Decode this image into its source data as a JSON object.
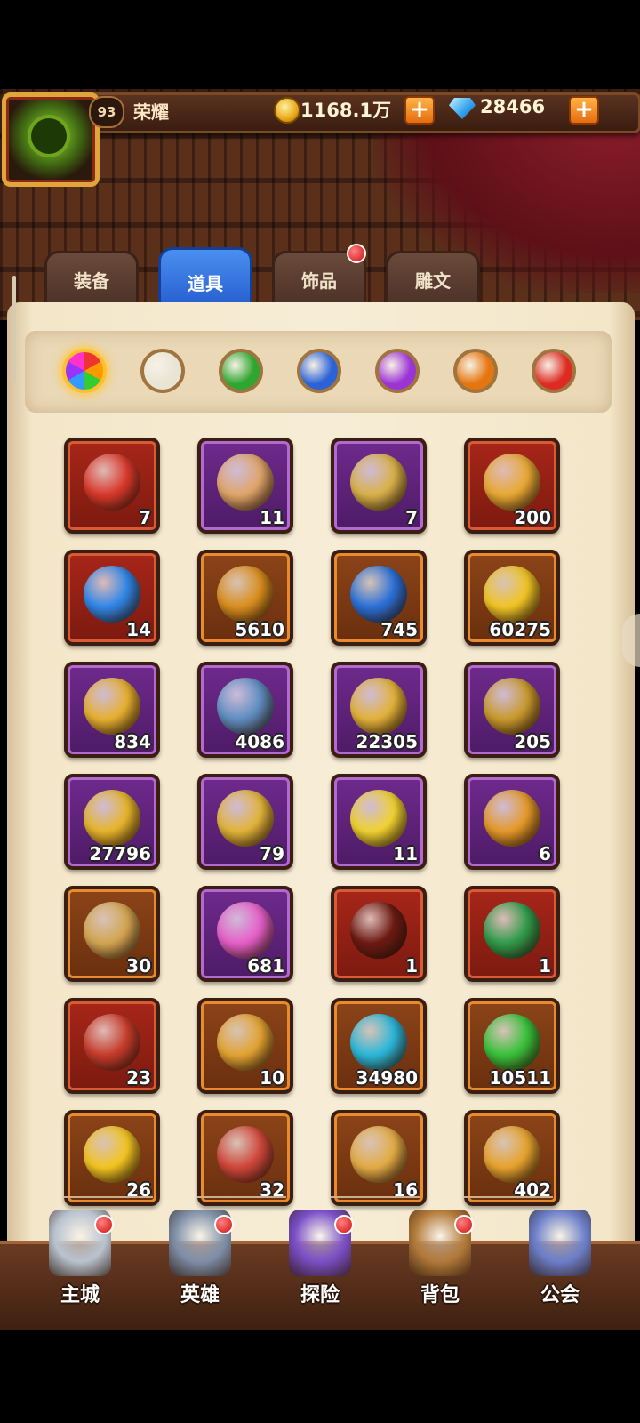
{
  "header": {
    "level": "93",
    "player_name": "荣耀",
    "gold": "1168.1万",
    "gems": "28466"
  },
  "tabs": [
    {
      "label": "装备",
      "active": false,
      "badge": false
    },
    {
      "label": "道具",
      "active": true,
      "badge": false
    },
    {
      "label": "饰品",
      "active": false,
      "badge": true
    },
    {
      "label": "雕文",
      "active": false,
      "badge": false
    }
  ],
  "color_filters": [
    {
      "name": "all",
      "color": "rainbow",
      "selected": true
    },
    {
      "name": "white",
      "color": "#e9e4d4",
      "selected": false
    },
    {
      "name": "green",
      "color": "#2fa630",
      "selected": false
    },
    {
      "name": "blue",
      "color": "#2b62d6",
      "selected": false
    },
    {
      "name": "purple",
      "color": "#9b34d4",
      "selected": false
    },
    {
      "name": "orange",
      "color": "#e5750f",
      "selected": false
    },
    {
      "name": "red",
      "color": "#dd2b22",
      "selected": false
    }
  ],
  "items": [
    {
      "name": "gold-pouch",
      "tier": "red",
      "qty": "7",
      "icon_color": "#d9382a"
    },
    {
      "name": "scroll",
      "tier": "purple",
      "qty": "11",
      "icon_color": "#e0a56a"
    },
    {
      "name": "treasure-chest-blue",
      "tier": "purple",
      "qty": "7",
      "icon_color": "#d9b14a"
    },
    {
      "name": "eagle-coin",
      "tier": "red",
      "qty": "200",
      "icon_color": "#e8a935"
    },
    {
      "name": "blue-stone",
      "tier": "red",
      "qty": "14",
      "icon_color": "#2f86e8"
    },
    {
      "name": "skull-coin",
      "tier": "orange",
      "qty": "5610",
      "icon_color": "#d98e1e"
    },
    {
      "name": "blue-crystal-ornament",
      "tier": "orange",
      "qty": "745",
      "icon_color": "#2a70d8"
    },
    {
      "name": "monkey-coin",
      "tier": "orange",
      "qty": "60275",
      "icon_color": "#f0c425"
    },
    {
      "name": "sun-badge",
      "tier": "purple",
      "qty": "834",
      "icon_color": "#e6b030"
    },
    {
      "name": "lightning-rune-stone",
      "tier": "purple",
      "qty": "4086",
      "icon_color": "#5f8ec2"
    },
    {
      "name": "winged-emblem",
      "tier": "purple",
      "qty": "22305",
      "icon_color": "#e2b23a"
    },
    {
      "name": "purple-gem-shield",
      "tier": "purple",
      "qty": "205",
      "icon_color": "#c99a2e"
    },
    {
      "name": "gold-shield",
      "tier": "purple",
      "qty": "27796",
      "icon_color": "#e6b52c"
    },
    {
      "name": "puzzle-piece",
      "tier": "purple",
      "qty": "79",
      "icon_color": "#e2b43a"
    },
    {
      "name": "gold-crystal",
      "tier": "purple",
      "qty": "11",
      "icon_color": "#f0d232"
    },
    {
      "name": "hex-coin",
      "tier": "purple",
      "qty": "6",
      "icon_color": "#e59a2a"
    },
    {
      "name": "star-coin",
      "tier": "orange",
      "qty": "30",
      "icon_color": "#d3a552"
    },
    {
      "name": "fireworks",
      "tier": "purple",
      "qty": "681",
      "icon_color": "#e65fc9"
    },
    {
      "name": "frame",
      "tier": "red",
      "qty": "1",
      "icon_color": "#6c1a12"
    },
    {
      "name": "green-chest",
      "tier": "red",
      "qty": "1",
      "icon_color": "#2f9b4a"
    },
    {
      "name": "red-chest",
      "tier": "red",
      "qty": "23",
      "icon_color": "#c63b2a"
    },
    {
      "name": "gold-chest",
      "tier": "orange",
      "qty": "10",
      "icon_color": "#e2a332"
    },
    {
      "name": "crown-chest",
      "tier": "orange",
      "qty": "34980",
      "icon_color": "#2ab7d9"
    },
    {
      "name": "green-rune-stone",
      "tier": "orange",
      "qty": "10511",
      "icon_color": "#38c13a"
    },
    {
      "name": "dragon-coin",
      "tier": "orange",
      "qty": "26",
      "icon_color": "#f2c421"
    },
    {
      "name": "red-banner-scroll",
      "tier": "orange",
      "qty": "32",
      "icon_color": "#d0473a"
    },
    {
      "name": "gold-scrolls",
      "tier": "orange",
      "qty": "16",
      "icon_color": "#e3ac46"
    },
    {
      "name": "rune-tablet",
      "tier": "orange",
      "qty": "402",
      "icon_color": "#e6a32e"
    }
  ],
  "nav": [
    {
      "label": "主城",
      "badge": true,
      "icon": "castle-icon",
      "color": "#b9c3cf"
    },
    {
      "label": "英雄",
      "badge": true,
      "icon": "hero-icon",
      "color": "#7f8fa8"
    },
    {
      "label": "探险",
      "badge": true,
      "icon": "portal-icon",
      "color": "#7a4fc6"
    },
    {
      "label": "背包",
      "badge": true,
      "icon": "backpack-icon",
      "color": "#b27a3a"
    },
    {
      "label": "公会",
      "badge": false,
      "icon": "guild-icon",
      "color": "#6c7fc9"
    }
  ]
}
